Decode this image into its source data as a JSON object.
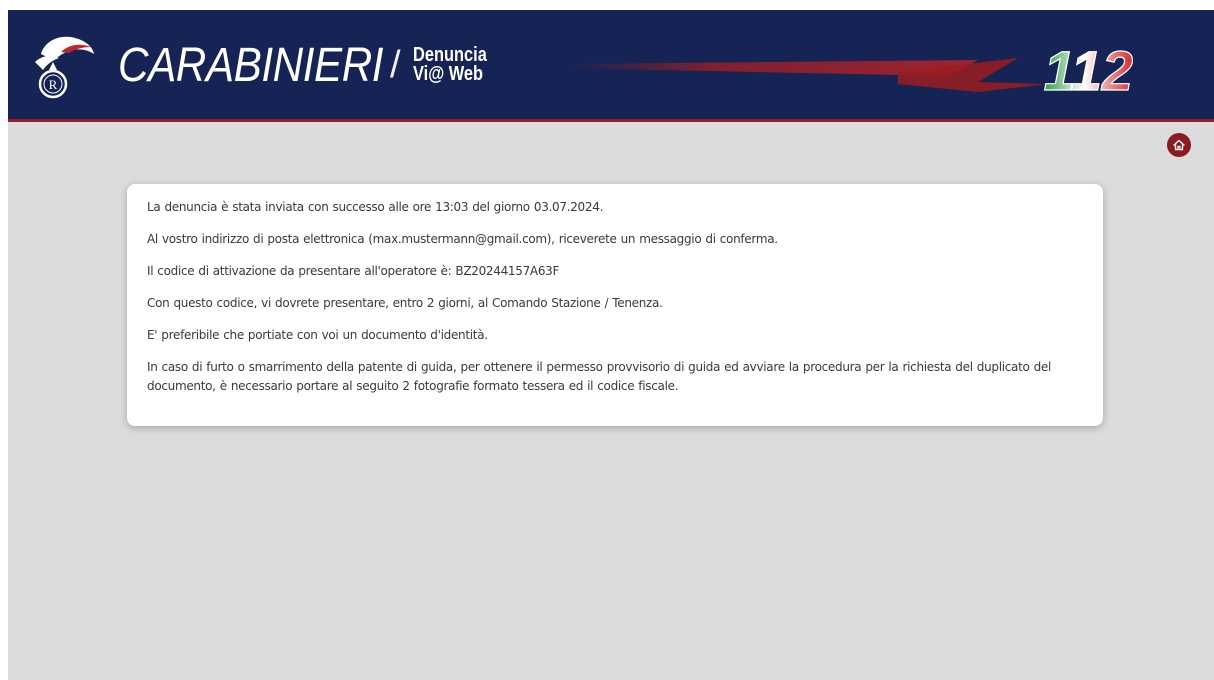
{
  "header": {
    "brand_name": "CARABINIERI",
    "brand_separator": "/",
    "brand_sub_line1": "Denuncia",
    "brand_sub_line2": "Vi@ Web",
    "emergency_number": "112",
    "background_color": "#152455",
    "accent_color": "#9b1c1f"
  },
  "nav": {
    "home_icon": "home-icon"
  },
  "confirmation": {
    "line1": "La denuncia è stata inviata con successo alle ore 13:03 del giorno 03.07.2024.",
    "line2": "Al vostro indirizzo di posta elettronica (max.mustermann@gmail.com), riceverete un messaggio di conferma.",
    "line3": "Il codice di attivazione da presentare all'operatore è: BZ20244157A63F",
    "line4": "Con questo codice, vi dovrete presentare, entro 2 giorni, al Comando Stazione / Tenenza.",
    "line5": "E' preferibile che portiate con voi un documento d'identità.",
    "line6": "In caso di furto o smarrimento della patente di guida, per ottenere il permesso provvisorio di guida ed avviare la procedura per la richiesta del duplicato del documento, è necessario portare al seguito 2 fotografie formato tessera ed il codice fiscale."
  }
}
